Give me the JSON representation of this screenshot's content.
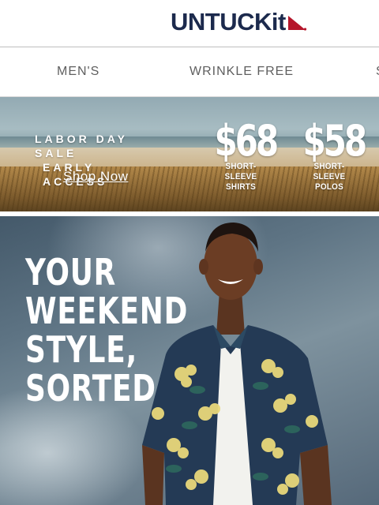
{
  "header": {
    "logo_text": "UNTUCKit",
    "logo_color": "#1c2a4d",
    "flag_color": "#b5162b"
  },
  "nav": {
    "items": [
      {
        "label": "MEN'S"
      },
      {
        "label": "WRINKLE FREE"
      },
      {
        "label": "S"
      }
    ]
  },
  "banner": {
    "sale_line1": "LABOR DAY SALE",
    "sale_line2": "EARLY ACCESS",
    "cta": "Shop Now",
    "offers": [
      {
        "price": "$68",
        "caption_line1": "SHORT-SLEEVE",
        "caption_line2": "SHIRTS"
      },
      {
        "price": "$58",
        "caption_line1": "SHORT-SLEEVE",
        "caption_line2": "POLOS"
      }
    ]
  },
  "hero": {
    "title_line1": "YOUR",
    "title_line2": "WEEKEND",
    "title_line3": "STYLE,",
    "title_line4": "SORTED"
  }
}
